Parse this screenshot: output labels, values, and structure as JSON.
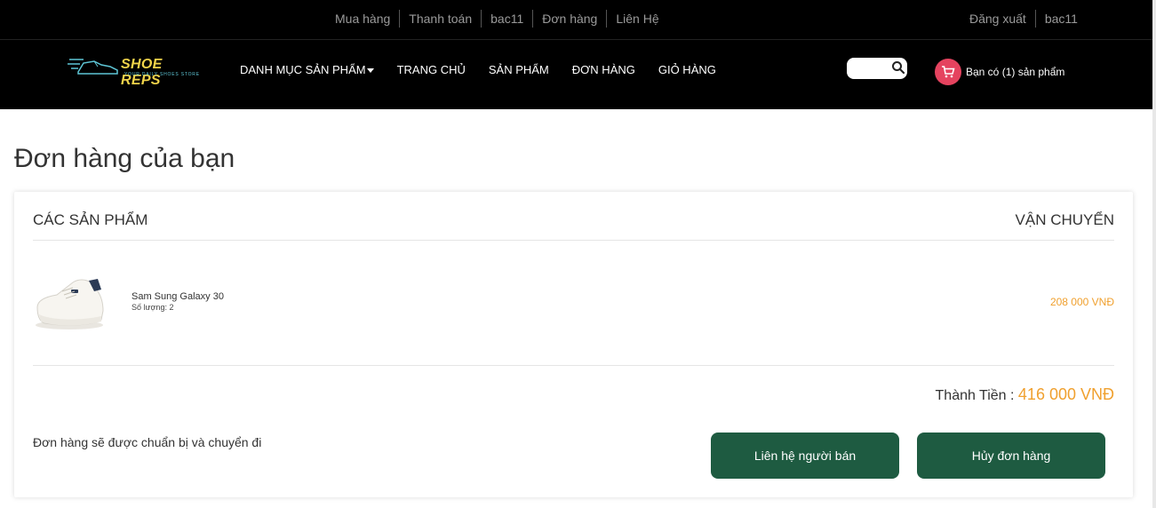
{
  "topbar": {
    "links": [
      "Mua hàng",
      "Thanh toán",
      "bac11",
      "Đơn hàng",
      "Liên Hệ"
    ],
    "right_links": [
      "Đăng xuất",
      "bac11"
    ]
  },
  "logo": {
    "brand": "SHOE REPS",
    "tagline": "YOUR DAILY SHOES STORE"
  },
  "nav": {
    "items": [
      "DANH MỤC SẢN PHẨM",
      "TRANG CHỦ",
      "SẢN PHẨM",
      "ĐƠN HÀNG",
      "GIỎ HÀNG"
    ]
  },
  "search": {
    "placeholder": ""
  },
  "cart": {
    "text": "Bạn có (1) sản phẩm"
  },
  "page": {
    "title": "Đơn hàng của bạn"
  },
  "order": {
    "col_products": "CÁC SẢN PHẨM",
    "col_shipping": "VẬN CHUYỂN",
    "item": {
      "name": "Sam Sung Galaxy 30",
      "quantity": "Số lượng: 2",
      "price": "208 000 VNĐ"
    },
    "total_label": "Thành Tiền :",
    "total_value": "416 000 VNĐ",
    "note": "Đơn hàng sẽ được chuẩn bị và chuyển đi",
    "contact_button": "Liên hệ người bán",
    "cancel_button": "Hủy đơn hàng"
  },
  "colors": {
    "accent": "#f0a02e",
    "button": "#1e5b41",
    "cart_badge": "#e5435f"
  }
}
